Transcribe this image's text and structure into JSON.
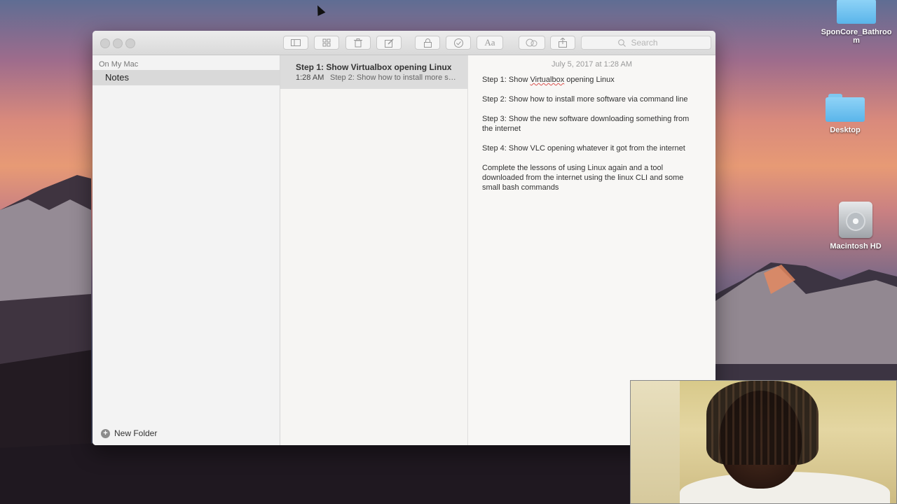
{
  "desktop": {
    "icons": [
      {
        "label": "SponCore_Bathroom",
        "icon": "folder-icon"
      },
      {
        "label": "Desktop",
        "icon": "folder-icon"
      },
      {
        "label": "Macintosh HD",
        "icon": "hard-drive-icon"
      }
    ]
  },
  "toolbar": {
    "search_placeholder": "Search"
  },
  "sidebar": {
    "section_label": "On My Mac",
    "folders": [
      {
        "label": "Notes"
      }
    ],
    "new_folder_label": "New Folder"
  },
  "note_list": {
    "items": [
      {
        "title": "Step 1: Show Virtualbox opening Linux",
        "time": "1:28 AM",
        "snippet": "Step 2: Show how to install more software via command line"
      }
    ]
  },
  "editor": {
    "date": "July 5, 2017 at 1:28 AM",
    "line1_prefix": "Step 1: Show ",
    "line1_misspelled": "Virtualbox",
    "line1_suffix": " opening Linux",
    "paragraphs": [
      "Step 2: Show how to install more software via command line",
      "Step 3: Show the new software downloading something from the internet",
      "Step 4: Show VLC opening whatever it got from the internet",
      "Complete the lessons of using Linux again and a tool downloaded from the internet using the linux CLI and some small bash commands"
    ]
  }
}
